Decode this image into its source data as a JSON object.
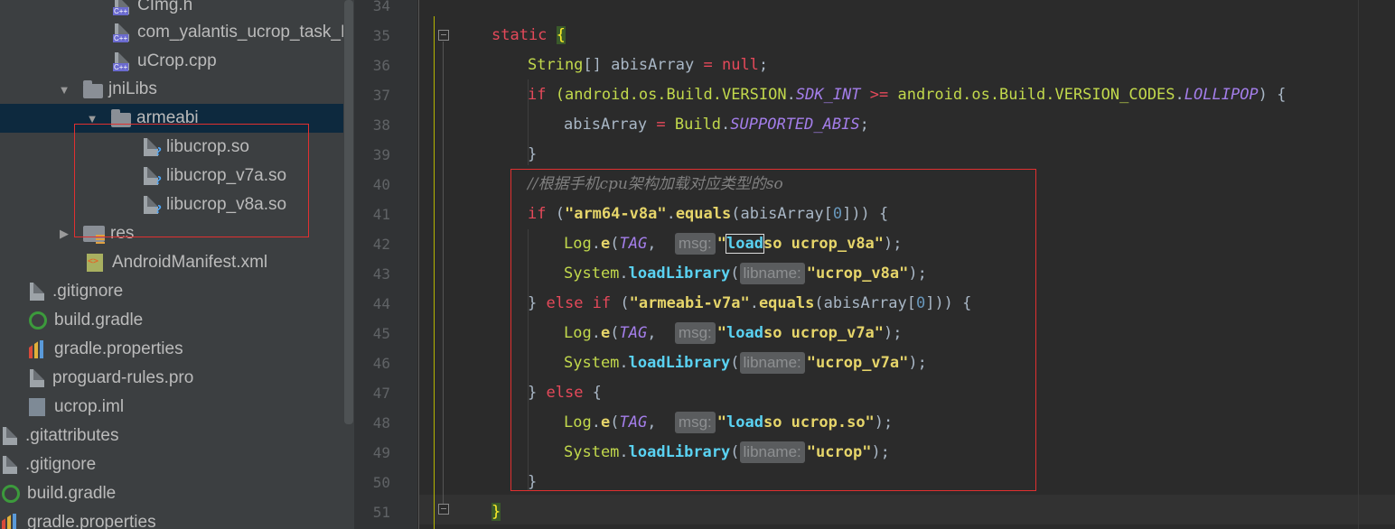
{
  "tree": {
    "items": [
      {
        "label": "CImg.h",
        "type": "cpp"
      },
      {
        "label": "com_yalantis_ucrop_task_BitmapCropTask.cpp",
        "type": "cpp"
      },
      {
        "label": "uCrop.cpp",
        "type": "cpp"
      },
      {
        "label": "jniLibs",
        "type": "folder",
        "expanded": true
      },
      {
        "label": "armeabi",
        "type": "folder",
        "expanded": true,
        "selected": true
      },
      {
        "label": "libucrop.so",
        "type": "unknown-file"
      },
      {
        "label": "libucrop_v7a.so",
        "type": "unknown-file"
      },
      {
        "label": "libucrop_v8a.so",
        "type": "unknown-file"
      },
      {
        "label": "res",
        "type": "res-folder",
        "expanded": false
      },
      {
        "label": "AndroidManifest.xml",
        "type": "xml"
      },
      {
        "label": ".gitignore",
        "type": "text"
      },
      {
        "label": "build.gradle",
        "type": "gradle"
      },
      {
        "label": "gradle.properties",
        "type": "properties"
      },
      {
        "label": "proguard-rules.pro",
        "type": "text"
      },
      {
        "label": "ucrop.iml",
        "type": "iml"
      },
      {
        "label": ".gitattributes",
        "type": "text"
      },
      {
        "label": ".gitignore",
        "type": "text"
      },
      {
        "label": "build.gradle",
        "type": "gradle"
      },
      {
        "label": "gradle.properties",
        "type": "properties"
      }
    ]
  },
  "editor": {
    "line_numbers": [
      "34",
      "35",
      "36",
      "37",
      "38",
      "39",
      "40",
      "41",
      "42",
      "43",
      "44",
      "45",
      "46",
      "47",
      "48",
      "49",
      "50",
      "51"
    ],
    "code": {
      "l35": {
        "kw": "static",
        "brace": "{"
      },
      "l36": {
        "type": "String",
        "rest": "[] abisArray",
        "eq": " = ",
        "null": "null",
        "end": ";"
      },
      "l37": {
        "kw": "if",
        "a": " (android.os.Build.",
        "b": "VERSION",
        "c": ".",
        "d": "SDK_INT",
        "e": " >= ",
        "f": "android.os.Build.",
        "g": "VERSION_CODES",
        "h": ".",
        "i": "LOLLIPOP",
        "j": ") {"
      },
      "l38": {
        "a": "abisArray",
        "eq": " = ",
        "b": "Build",
        "c": ".",
        "d": "SUPPORTED_ABIS",
        "e": ";"
      },
      "l39": "}",
      "l40": "//根据手机cpu架构加载对应类型的so",
      "l41": {
        "kw": "if",
        "a": " (",
        "s": "\"arm64-v8a\"",
        "b": ".",
        "m": "equals",
        "c": "(abisArray[",
        "n": "0",
        "d": "])) {"
      },
      "l42": {
        "a": "Log",
        "b": ".",
        "m": "e",
        "c": "(",
        "tag": "TAG",
        "d": ", ",
        "hint": "msg:",
        "q1": "\"",
        "load": "load",
        "s": "so ucrop_v8a\"",
        "e": ");"
      },
      "l43": {
        "a": "System",
        "b": ".",
        "m": "loadLibrary",
        "c": "(",
        "hint": "libname:",
        "s": "\"ucrop_v8a\"",
        "e": ");"
      },
      "l44": {
        "a": "} ",
        "kw": "else if",
        "b": " (",
        "s": "\"armeabi-v7a\"",
        "c": ".",
        "m": "equals",
        "d": "(abisArray[",
        "n": "0",
        "e": "])) {"
      },
      "l45": {
        "a": "Log",
        "b": ".",
        "m": "e",
        "c": "(",
        "tag": "TAG",
        "d": ", ",
        "hint": "msg:",
        "q1": "\"",
        "load": "load",
        "s": "so ucrop_v7a\"",
        "e": ");"
      },
      "l46": {
        "a": "System",
        "b": ".",
        "m": "loadLibrary",
        "c": "(",
        "hint": "libname:",
        "s": "\"ucrop_v7a\"",
        "e": ");"
      },
      "l47": {
        "a": "} ",
        "kw": "else",
        "b": " {"
      },
      "l48": {
        "a": "Log",
        "b": ".",
        "m": "e",
        "c": "(",
        "tag": "TAG",
        "d": ", ",
        "hint": "msg:",
        "q1": "\"",
        "load": "load",
        "s": "so ucrop.so\"",
        "e": ");"
      },
      "l49": {
        "a": "System",
        "b": ".",
        "m": "loadLibrary",
        "c": "(",
        "hint": "libname:",
        "s": "\"ucrop\"",
        "e": ");"
      },
      "l50": "}",
      "l51": "}"
    }
  },
  "colors": {
    "keyword": "#e5495a",
    "type": "#c2d94c",
    "static_field": "#a47eea",
    "string": "#e6d56a",
    "method": "#5ad2f2",
    "number": "#6897bb",
    "comment": "#808080",
    "annotation_box": "#e03030"
  }
}
